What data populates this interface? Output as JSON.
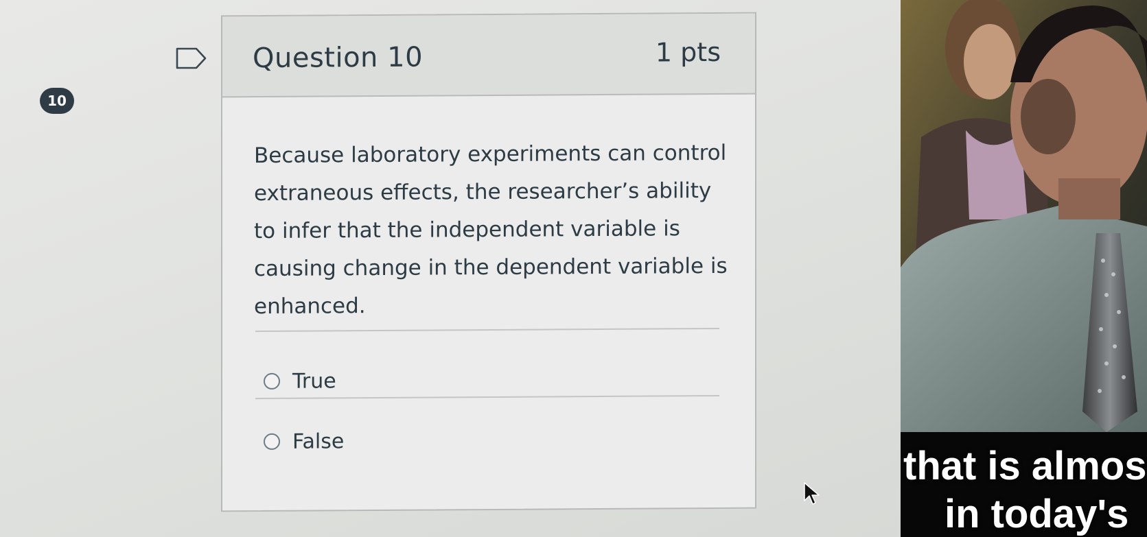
{
  "question": {
    "number_badge": "10",
    "title": "Question 10",
    "points": "1 pts",
    "text": "Because laboratory experiments can control extraneous effects, the researcher’s ability to infer that the independent variable is causing change in the dependent variable is enhanced.",
    "answers": [
      {
        "label": "True",
        "selected": false
      },
      {
        "label": "False",
        "selected": false
      }
    ]
  },
  "video_overlay": {
    "caption_line_1": "that is almos",
    "caption_line_2": "in today's"
  },
  "icons": {
    "flag": "flag-icon",
    "radio": "radio-icon",
    "cursor": "mouse-cursor-icon"
  },
  "colors": {
    "badge": "#2f3b45",
    "text": "#2d3b45",
    "card_header": "#dcdedc",
    "card_border": "#b6b9b8"
  }
}
